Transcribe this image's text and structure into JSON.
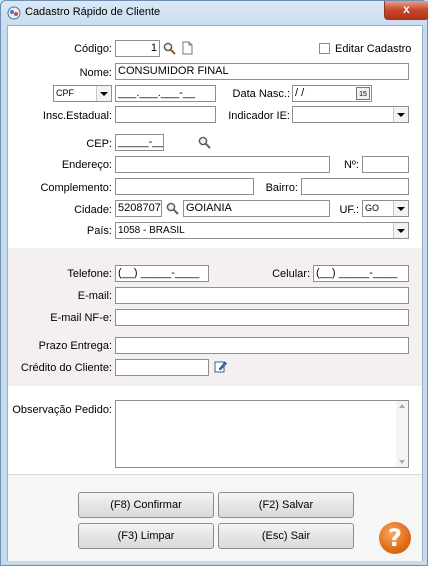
{
  "window": {
    "title": "Cadastro Rápido de Cliente",
    "close_glyph": "x"
  },
  "labels": {
    "codigo": "Código:",
    "editar_cadastro": "Editar Cadastro",
    "nome": "Nome:",
    "data_nasc": "Data Nasc.:",
    "insc_estadual": "Insc.Estadual:",
    "indicador_ie": "Indicador IE:",
    "cep": "CEP:",
    "endereco": "Endereço:",
    "numero": "Nº:",
    "complemento": "Complemento:",
    "bairro": "Bairro:",
    "cidade": "Cidade:",
    "uf": "UF.:",
    "pais": "País:",
    "telefone": "Telefone:",
    "celular": "Celular:",
    "email": "E-mail:",
    "email_nfe": "E-mail NF-e:",
    "prazo_entrega": "Prazo Entrega:",
    "credito": "Crédito do Cliente:",
    "observacao": "Observação Pedido:"
  },
  "fields": {
    "codigo": "1",
    "nome": "CONSUMIDOR FINAL",
    "doc_type": "CPF",
    "doc_mask": "___.___.___-__",
    "data_nasc": " /  /",
    "calendar_glyph": "15",
    "insc_estadual": "",
    "indicador_ie": "",
    "cep_mask": "_____-___",
    "endereco": "",
    "numero": "",
    "complemento": "",
    "bairro": "",
    "cidade_codigo": "5208707",
    "cidade_nome": "GOIANIA",
    "uf": "GO",
    "pais": "1058 - BRASIL",
    "telefone_mask": "(__) _____-____",
    "celular_mask": "(__) _____-____",
    "email": "",
    "email_nfe": "",
    "prazo_entrega": "",
    "credito": "",
    "observacao": ""
  },
  "buttons": {
    "confirmar": "(F8) Confirmar",
    "salvar": "(F2) Salvar",
    "limpar": "(F3) Limpar",
    "sair": "(Esc) Sair",
    "help": "?"
  },
  "colors": {
    "help_orange": "#e06b17",
    "title_bar": "#cfe0f1",
    "close_red": "#c7462c"
  }
}
